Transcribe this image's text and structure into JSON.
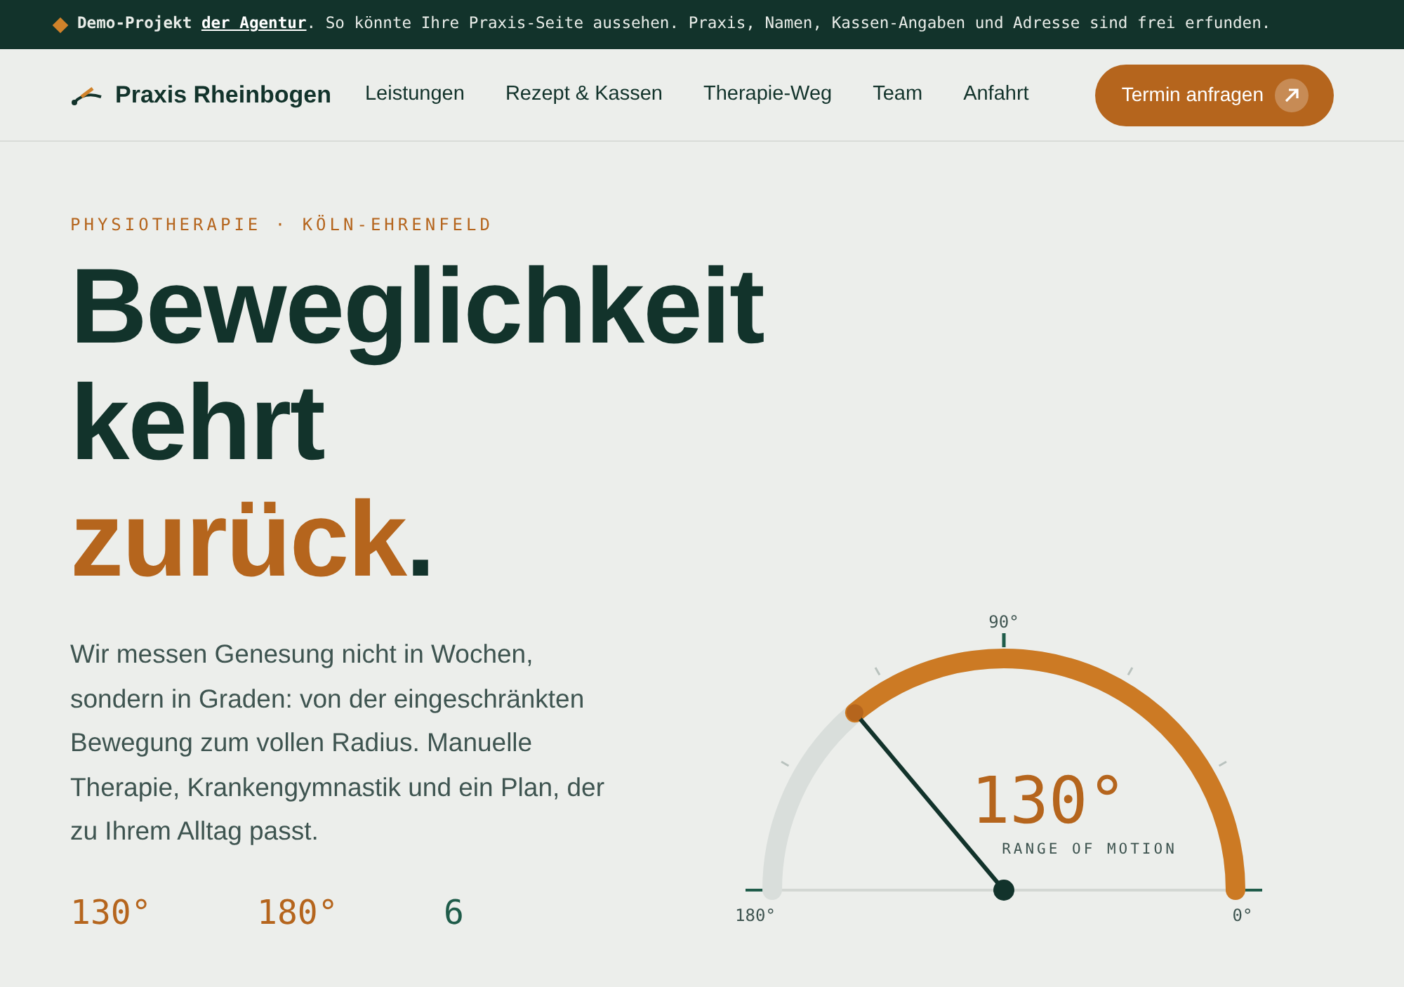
{
  "banner": {
    "lead": "Demo-Projekt",
    "link": "der Agentur",
    "text": ". So könnte Ihre Praxis-Seite aussehen. Praxis, Namen, Kassen-Angaben und Adresse sind frei erfunden."
  },
  "nav": {
    "brand": "Praxis Rheinbogen",
    "items": [
      "Leistungen",
      "Rezept & Kassen",
      "Therapie-Weg",
      "Team",
      "Anfahrt"
    ],
    "cta": "Termin anfragen"
  },
  "hero": {
    "eyebrow": "PHYSIOTHERAPIE · KÖLN-EHRENFELD",
    "headline": [
      "Beweglichkeit",
      "kehrt"
    ],
    "accent": "zurück",
    "period": ".",
    "text": "Wir messen Genesung nicht in Wochen, sondern in Graden: von der eingeschränkten Bewegung zum vollen Radius. Manuelle Therapie, Krankengymnastik und ein Plan, der zu Ihrem Alltag passt.",
    "stats": [
      {
        "value": "130°",
        "color": "#b5651d"
      },
      {
        "value": "180°",
        "color": "#b5651d"
      },
      {
        "value": "6",
        "color": "#1f5c4a"
      }
    ]
  },
  "gauge": {
    "reading": "130°",
    "caption": "RANGE OF MOTION",
    "labels": [
      "180°",
      "90°",
      "0°"
    ]
  }
}
